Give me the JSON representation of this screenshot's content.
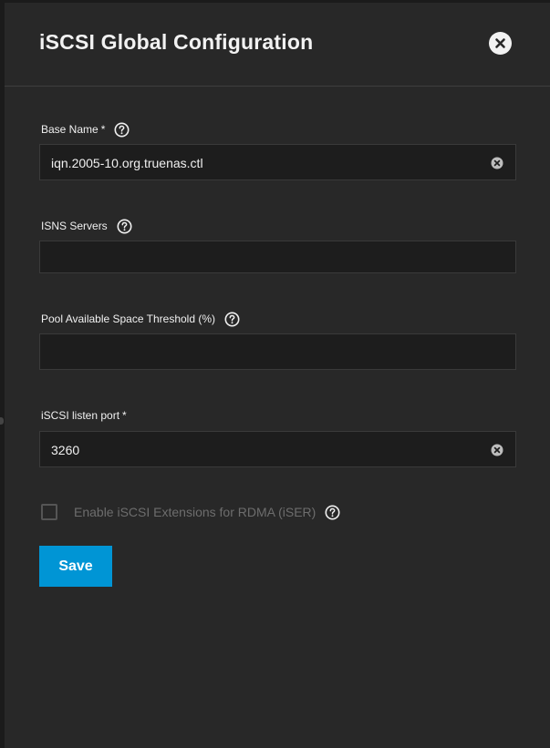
{
  "dialog": {
    "title": "iSCSI Global Configuration",
    "close_icon": "close-circle-icon"
  },
  "fields": {
    "base_name": {
      "label": "Base Name",
      "required_marker": "*",
      "value": "iqn.2005-10.org.truenas.ctl",
      "help_icon": "help-circle-icon",
      "clear_icon": "clear-circle-icon"
    },
    "isns_servers": {
      "label": "ISNS Servers",
      "value": "",
      "help_icon": "help-circle-icon"
    },
    "pool_threshold": {
      "label": "Pool Available Space Threshold (%)",
      "value": "",
      "help_icon": "help-circle-icon"
    },
    "listen_port": {
      "label": "iSCSI listen port",
      "required_marker": "*",
      "value": "3260",
      "help_icon": "help-circle-icon",
      "clear_icon": "clear-circle-icon"
    }
  },
  "iser": {
    "label": "Enable iSCSI Extensions for RDMA (iSER)",
    "checked": false,
    "help_icon": "help-circle-icon"
  },
  "actions": {
    "save_label": "Save"
  },
  "colors": {
    "panel_bg": "#282828",
    "input_bg": "#1d1d1d",
    "accent": "#0095d5",
    "text": "#f0f0f0",
    "disabled_text": "#6d6d6d"
  }
}
